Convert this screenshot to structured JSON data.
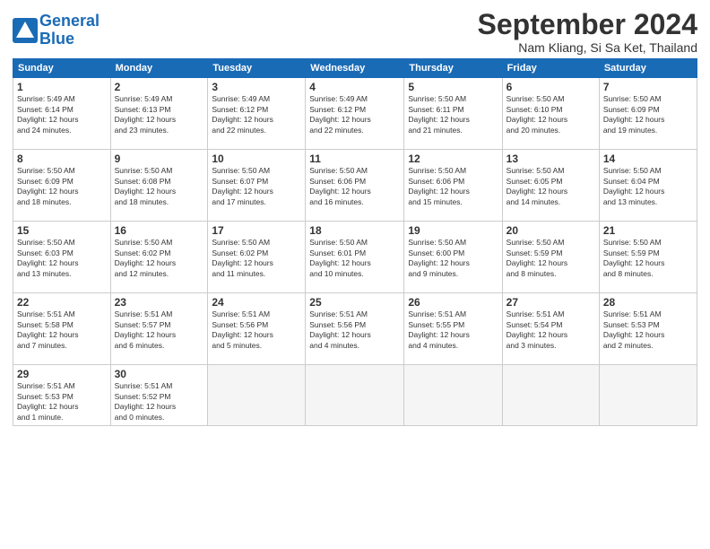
{
  "header": {
    "logo_line1": "General",
    "logo_line2": "Blue",
    "month": "September 2024",
    "location": "Nam Kliang, Si Sa Ket, Thailand"
  },
  "weekdays": [
    "Sunday",
    "Monday",
    "Tuesday",
    "Wednesday",
    "Thursday",
    "Friday",
    "Saturday"
  ],
  "weeks": [
    [
      {
        "day": "1",
        "info": "Sunrise: 5:49 AM\nSunset: 6:14 PM\nDaylight: 12 hours\nand 24 minutes."
      },
      {
        "day": "2",
        "info": "Sunrise: 5:49 AM\nSunset: 6:13 PM\nDaylight: 12 hours\nand 23 minutes."
      },
      {
        "day": "3",
        "info": "Sunrise: 5:49 AM\nSunset: 6:12 PM\nDaylight: 12 hours\nand 22 minutes."
      },
      {
        "day": "4",
        "info": "Sunrise: 5:49 AM\nSunset: 6:12 PM\nDaylight: 12 hours\nand 22 minutes."
      },
      {
        "day": "5",
        "info": "Sunrise: 5:50 AM\nSunset: 6:11 PM\nDaylight: 12 hours\nand 21 minutes."
      },
      {
        "day": "6",
        "info": "Sunrise: 5:50 AM\nSunset: 6:10 PM\nDaylight: 12 hours\nand 20 minutes."
      },
      {
        "day": "7",
        "info": "Sunrise: 5:50 AM\nSunset: 6:09 PM\nDaylight: 12 hours\nand 19 minutes."
      }
    ],
    [
      {
        "day": "8",
        "info": "Sunrise: 5:50 AM\nSunset: 6:09 PM\nDaylight: 12 hours\nand 18 minutes."
      },
      {
        "day": "9",
        "info": "Sunrise: 5:50 AM\nSunset: 6:08 PM\nDaylight: 12 hours\nand 18 minutes."
      },
      {
        "day": "10",
        "info": "Sunrise: 5:50 AM\nSunset: 6:07 PM\nDaylight: 12 hours\nand 17 minutes."
      },
      {
        "day": "11",
        "info": "Sunrise: 5:50 AM\nSunset: 6:06 PM\nDaylight: 12 hours\nand 16 minutes."
      },
      {
        "day": "12",
        "info": "Sunrise: 5:50 AM\nSunset: 6:06 PM\nDaylight: 12 hours\nand 15 minutes."
      },
      {
        "day": "13",
        "info": "Sunrise: 5:50 AM\nSunset: 6:05 PM\nDaylight: 12 hours\nand 14 minutes."
      },
      {
        "day": "14",
        "info": "Sunrise: 5:50 AM\nSunset: 6:04 PM\nDaylight: 12 hours\nand 13 minutes."
      }
    ],
    [
      {
        "day": "15",
        "info": "Sunrise: 5:50 AM\nSunset: 6:03 PM\nDaylight: 12 hours\nand 13 minutes."
      },
      {
        "day": "16",
        "info": "Sunrise: 5:50 AM\nSunset: 6:02 PM\nDaylight: 12 hours\nand 12 minutes."
      },
      {
        "day": "17",
        "info": "Sunrise: 5:50 AM\nSunset: 6:02 PM\nDaylight: 12 hours\nand 11 minutes."
      },
      {
        "day": "18",
        "info": "Sunrise: 5:50 AM\nSunset: 6:01 PM\nDaylight: 12 hours\nand 10 minutes."
      },
      {
        "day": "19",
        "info": "Sunrise: 5:50 AM\nSunset: 6:00 PM\nDaylight: 12 hours\nand 9 minutes."
      },
      {
        "day": "20",
        "info": "Sunrise: 5:50 AM\nSunset: 5:59 PM\nDaylight: 12 hours\nand 8 minutes."
      },
      {
        "day": "21",
        "info": "Sunrise: 5:50 AM\nSunset: 5:59 PM\nDaylight: 12 hours\nand 8 minutes."
      }
    ],
    [
      {
        "day": "22",
        "info": "Sunrise: 5:51 AM\nSunset: 5:58 PM\nDaylight: 12 hours\nand 7 minutes."
      },
      {
        "day": "23",
        "info": "Sunrise: 5:51 AM\nSunset: 5:57 PM\nDaylight: 12 hours\nand 6 minutes."
      },
      {
        "day": "24",
        "info": "Sunrise: 5:51 AM\nSunset: 5:56 PM\nDaylight: 12 hours\nand 5 minutes."
      },
      {
        "day": "25",
        "info": "Sunrise: 5:51 AM\nSunset: 5:56 PM\nDaylight: 12 hours\nand 4 minutes."
      },
      {
        "day": "26",
        "info": "Sunrise: 5:51 AM\nSunset: 5:55 PM\nDaylight: 12 hours\nand 4 minutes."
      },
      {
        "day": "27",
        "info": "Sunrise: 5:51 AM\nSunset: 5:54 PM\nDaylight: 12 hours\nand 3 minutes."
      },
      {
        "day": "28",
        "info": "Sunrise: 5:51 AM\nSunset: 5:53 PM\nDaylight: 12 hours\nand 2 minutes."
      }
    ],
    [
      {
        "day": "29",
        "info": "Sunrise: 5:51 AM\nSunset: 5:53 PM\nDaylight: 12 hours\nand 1 minute."
      },
      {
        "day": "30",
        "info": "Sunrise: 5:51 AM\nSunset: 5:52 PM\nDaylight: 12 hours\nand 0 minutes."
      },
      null,
      null,
      null,
      null,
      null
    ]
  ]
}
